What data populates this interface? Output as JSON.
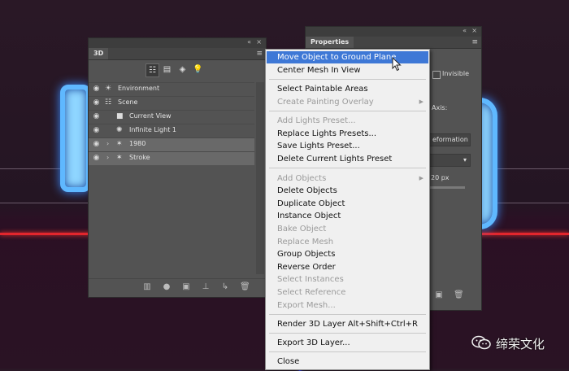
{
  "panel3d": {
    "tab": "3D",
    "titlebar_controls": [
      "«",
      "×"
    ],
    "menu_icon": "≡",
    "toolbar": [
      {
        "icon": "scene-icon",
        "glyph": "☷",
        "active": true
      },
      {
        "icon": "mesh-icon",
        "glyph": "▤",
        "active": false
      },
      {
        "icon": "material-icon",
        "glyph": "◈",
        "active": false
      },
      {
        "icon": "light-icon",
        "glyph": "💡",
        "active": false
      }
    ],
    "layers": [
      {
        "name": "Environment",
        "glyph": "☀",
        "icon": "environment-icon"
      },
      {
        "name": "Scene",
        "glyph": "☷",
        "icon": "scene-icon"
      },
      {
        "name": "Current View",
        "glyph": "■",
        "icon": "camera-icon"
      },
      {
        "name": "Infinite Light 1",
        "glyph": "✺",
        "icon": "infinite-light-icon"
      },
      {
        "name": "1980",
        "glyph": "✶",
        "icon": "mesh-icon",
        "expandable": true,
        "selected": true
      },
      {
        "name": "Stroke",
        "glyph": "✶",
        "icon": "mesh-icon",
        "expandable": true,
        "selected": true
      }
    ],
    "bottom_buttons": [
      {
        "icon": "mesh-filter-icon",
        "glyph": "▥"
      },
      {
        "icon": "light-filter-icon",
        "glyph": "●"
      },
      {
        "icon": "render-icon",
        "glyph": "▣"
      },
      {
        "icon": "ground-plane-icon",
        "glyph": "⊥"
      },
      {
        "icon": "add-light-icon",
        "glyph": "↳"
      },
      {
        "icon": "trash-icon",
        "glyph": "🗑"
      }
    ]
  },
  "properties": {
    "tab": "Properties",
    "titlebar_controls": [
      "«",
      "×"
    ],
    "menu_icon": "≡",
    "invisible_label": "Invisible",
    "axis_label": "Axis:",
    "deformation_label": "eformation",
    "dropdown_arrow": "▾",
    "depth_value": "20 px",
    "bottom_buttons": [
      {
        "icon": "render-icon",
        "glyph": "▣"
      },
      {
        "icon": "trash-icon",
        "glyph": "🗑"
      }
    ]
  },
  "context_menu": {
    "items": [
      {
        "label": "Move Object to Ground Plane",
        "highlighted": true
      },
      {
        "label": "Center Mesh In View"
      },
      {
        "separator": true
      },
      {
        "label": "Select Paintable Areas"
      },
      {
        "label": "Create Painting Overlay",
        "disabled": true,
        "submenu": true
      },
      {
        "separator": true
      },
      {
        "label": "Add Lights Preset...",
        "disabled": true
      },
      {
        "label": "Replace Lights Presets..."
      },
      {
        "label": "Save Lights Preset..."
      },
      {
        "label": "Delete Current Lights Preset"
      },
      {
        "separator": true
      },
      {
        "label": "Add Objects",
        "disabled": true,
        "submenu": true
      },
      {
        "label": "Delete Objects"
      },
      {
        "label": "Duplicate Object"
      },
      {
        "label": "Instance Object"
      },
      {
        "label": "Bake Object",
        "disabled": true
      },
      {
        "label": "Replace Mesh",
        "disabled": true
      },
      {
        "label": "Group Objects"
      },
      {
        "label": "Reverse Order"
      },
      {
        "label": "Select Instances",
        "disabled": true
      },
      {
        "label": "Select Reference",
        "disabled": true
      },
      {
        "label": "Export Mesh...",
        "disabled": true
      },
      {
        "separator": true
      },
      {
        "label": "Render 3D Layer",
        "shortcut": "Alt+Shift+Ctrl+R"
      },
      {
        "separator": true
      },
      {
        "label": "Export 3D Layer..."
      },
      {
        "separator": true
      },
      {
        "label": "Close"
      }
    ],
    "submenu_arrow": "▶"
  },
  "watermark": {
    "text": "缔荣文化",
    "icon": "wechat-icon"
  }
}
